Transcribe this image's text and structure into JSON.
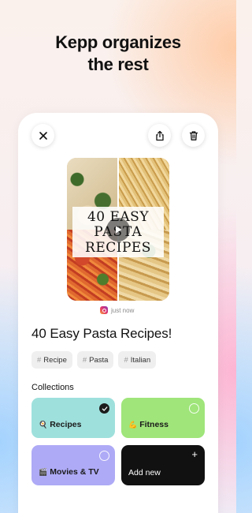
{
  "headline": {
    "line1": "Kepp organizes",
    "line2": "the rest"
  },
  "toolbar": {
    "close_icon": "close-icon",
    "share_icon": "share-icon",
    "delete_icon": "trash-icon"
  },
  "post": {
    "thumbnail_title_line1": "40 EASY",
    "thumbnail_title_line2": "PASTA",
    "thumbnail_title_line3": "RECIPES",
    "source_icon": "instagram-icon",
    "timestamp": "just now",
    "title": "40 Easy Pasta Recipes!",
    "tags": [
      "Recipe",
      "Pasta",
      "Italian"
    ]
  },
  "collections": {
    "label": "Collections",
    "items": [
      {
        "emoji": "🍳",
        "label": "Recipes",
        "selected": true,
        "color": "#9ee0dc"
      },
      {
        "emoji": "💪",
        "label": "Fitness",
        "selected": false,
        "color": "#9fe57a"
      },
      {
        "emoji": "🎬",
        "label": "Movies & TV",
        "selected": false,
        "color": "#aeaaf6"
      }
    ],
    "add_new_label": "Add new",
    "add_new_icon": "plus-icon"
  },
  "colors": {
    "card_bg": "#ffffff",
    "add_new_bg": "#111111",
    "tag_bg": "#efefef"
  }
}
